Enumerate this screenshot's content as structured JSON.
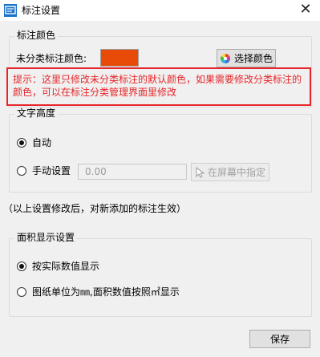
{
  "window": {
    "title": "标注设置",
    "close_glyph": "✕"
  },
  "color_group": {
    "label": "标注颜色",
    "field_label": "未分类标注颜色:",
    "swatch_color": "#e84a07",
    "pick_button": "选择颜色"
  },
  "warning": {
    "text": "提示：这里只修改未分类标注的默认颜色，如果需要修改分类标注的颜色，可以在标注分类管理界面里修改",
    "color": "#e6262a"
  },
  "text_height_group": {
    "label": "文字高度",
    "option_auto": "自动",
    "option_manual": "手动设置",
    "manual_value": "0.00",
    "pick_on_screen_button": "在屏幕中指定",
    "selected": "auto"
  },
  "note": "（以上设置修改后，对新添加的标注生效）",
  "area_group": {
    "label": "面积显示设置",
    "option_actual": "按实际数值显示",
    "option_unit": "图纸单位为㎜,面积数值按照㎡显示",
    "selected": "actual"
  },
  "footer": {
    "save_button": "保存"
  }
}
